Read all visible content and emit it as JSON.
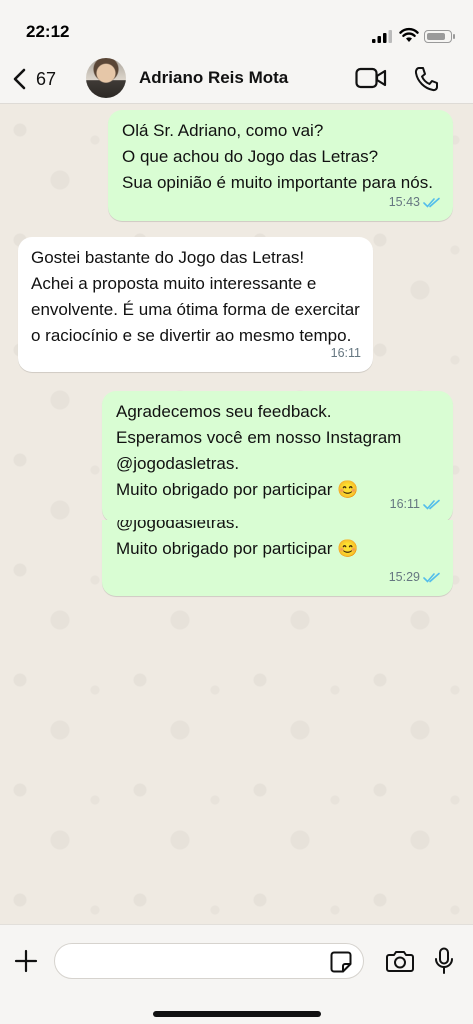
{
  "status_bar": {
    "time": "22:12"
  },
  "header": {
    "back_count": "67",
    "contact_name": "Adriano Reis Mota",
    "icons": [
      "chevron-left-icon",
      "video-camera-icon",
      "phone-icon"
    ]
  },
  "messages": [
    {
      "direction": "out",
      "text": "Olá Sr. Adriano, como vai?\nO que achou do Jogo das Letras?\nSua opinião é muito importante para nós.",
      "time": "15:43",
      "status": "read"
    },
    {
      "direction": "in",
      "text": "Gostei bastante do Jogo das Letras!\nAchei a proposta muito interessante e envolvente. É uma ótima forma de exercitar o raciocínio e se divertir ao mesmo tempo.",
      "time": "16:11"
    },
    {
      "direction": "out",
      "text": "Agradecemos seu feedback.\nEsperamos você em nosso Instagram @jogodasletras.\nMuito obrigado por participar 😊",
      "time": "16:11",
      "status": "read"
    },
    {
      "direction": "out",
      "text": "@jogodasletras.\nMuito obrigado por participar 😊",
      "time": "15:29",
      "status": "read",
      "partially_hidden": true
    }
  ],
  "composer": {
    "placeholder": "",
    "icons": [
      "plus-icon",
      "sticker-icon",
      "camera-icon",
      "microphone-icon"
    ]
  },
  "colors": {
    "outgoing_bubble": "#d9fdd3",
    "incoming_bubble": "#ffffff",
    "background": "#efeae2",
    "read_ticks": "#53bdeb"
  }
}
